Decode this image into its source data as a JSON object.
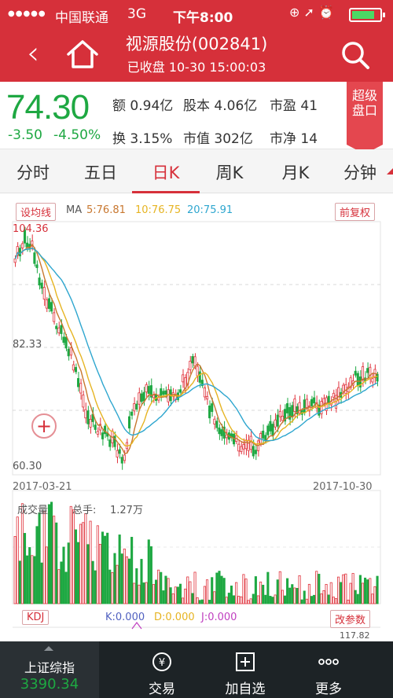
{
  "status_bar": {
    "signal": "●●●●●",
    "carrier": "中国联通",
    "network": "3G",
    "time": "下午8:00",
    "icons": "⊕ ➚ ⏰"
  },
  "header": {
    "title": "视源股份(002841)",
    "subtitle": "已收盘 10-30 15:00:03"
  },
  "quote": {
    "price": "74.30",
    "change": "-3.50",
    "change_pct": "-4.50%",
    "stats": [
      {
        "label": "额",
        "value": "0.94亿"
      },
      {
        "label": "股本",
        "value": "4.06亿"
      },
      {
        "label": "市盈",
        "value": "41"
      },
      {
        "label": "换",
        "value": "3.15%"
      },
      {
        "label": "市值",
        "value": "302亿"
      },
      {
        "label": "市净",
        "value": "14"
      }
    ],
    "super_panel": "超级\n盘口"
  },
  "tabs": [
    "分时",
    "五日",
    "日K",
    "周K",
    "月K",
    "分钟"
  ],
  "active_tab": "日K",
  "kline": {
    "ma_button": "设均线",
    "ma_prefix": "MA",
    "ma5": "5:76.81",
    "ma10": "10:76.75",
    "ma20": "20:75.91",
    "adjust_button": "前复权",
    "price_high": "104.36",
    "price_mid": "82.33",
    "price_low": "60.30",
    "date_start": "2017-03-21",
    "date_end": "2017-10-30",
    "volume_label": "成交量",
    "volume_total_label": "总手:",
    "volume_total": "1.27万",
    "kdj_button": "KDJ",
    "k": "K:0.000",
    "d": "D:0.000",
    "j": "J:0.000",
    "param_button": "改参数",
    "kdj_top": "117.82"
  },
  "colors": {
    "brand_red": "#d6303a",
    "down_green": "#1ea842",
    "ma5": "#c8772f",
    "ma10": "#e6b422",
    "ma20": "#2ea6cf"
  },
  "bottom_bar": {
    "index_name": "上证综指",
    "index_value": "3390.34",
    "buttons": [
      "交易",
      "加自选",
      "更多"
    ]
  }
}
